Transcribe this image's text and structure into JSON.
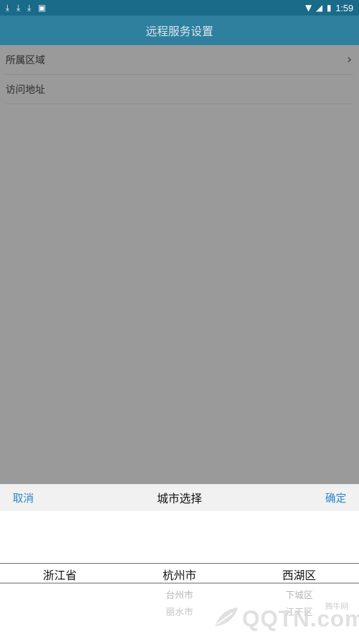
{
  "status_bar": {
    "time": "1:59",
    "left_icons": [
      "download-icon",
      "download-icon",
      "download-icon",
      "image-icon"
    ],
    "right_icons": [
      "wifi-icon",
      "signal-icon",
      "battery-icon"
    ]
  },
  "header": {
    "title": "远程服务设置"
  },
  "form": {
    "region_label": "所属区域",
    "address_label": "访问地址"
  },
  "picker": {
    "cancel_label": "取消",
    "title": "城市选择",
    "confirm_label": "确定",
    "columns": [
      {
        "selected": "浙江省",
        "options": []
      },
      {
        "selected": "杭州市",
        "options": [
          "台州市",
          "丽水市"
        ]
      },
      {
        "selected": "西湖区",
        "options": [
          "下城区",
          "江干区"
        ]
      }
    ]
  },
  "watermark": {
    "text": "QQTN.com",
    "small": "腾牛网"
  },
  "colors": {
    "header": "#2f7f9f",
    "status_bar": "#1a6a8a",
    "accent": "#2a86c8",
    "overlay": "#9a9a9a"
  }
}
